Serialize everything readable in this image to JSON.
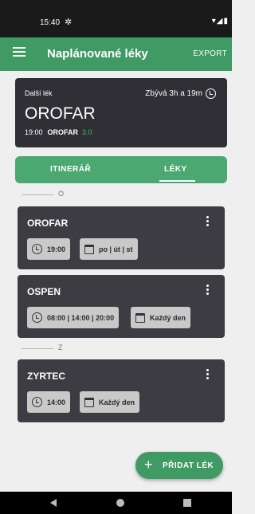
{
  "status_bar": {
    "time": "15:40",
    "settings_icon": "gear-icon",
    "system_icons": "▾◢▮"
  },
  "app_bar": {
    "menu_icon": "hamburger-icon",
    "title": "Naplánované léky",
    "action": "EXPORT"
  },
  "next_dose": {
    "label": "Další lék",
    "remaining": "Zbývá 3h a 19m",
    "drug_name": "OROFAR",
    "time": "19:00",
    "drug_short": "OROFAR",
    "dose": "3.0"
  },
  "tabs": [
    {
      "label": "ITINERÁŘ",
      "selected": false
    },
    {
      "label": "LÉKY",
      "selected": true
    }
  ],
  "sections": [
    {
      "letter": "O",
      "items": [
        {
          "name": "OROFAR",
          "times": "19:00",
          "days": "po | út | st"
        },
        {
          "name": "OSPEN",
          "times": "08:00 | 14:00 | 20:00",
          "days": "Každý den"
        }
      ]
    },
    {
      "letter": "Z",
      "items": [
        {
          "name": "ZYRTEC",
          "times": "14:00",
          "days": "Každý den"
        }
      ]
    }
  ],
  "fab": {
    "label": "PŘIDAT LÉK",
    "icon": "plus-icon"
  },
  "colors": {
    "primary": "#3f9a63",
    "card_dark": "#2f2f35",
    "med_card": "#3d3c43",
    "chip": "#c9c9c9",
    "dose_green": "#3fbf6f"
  }
}
